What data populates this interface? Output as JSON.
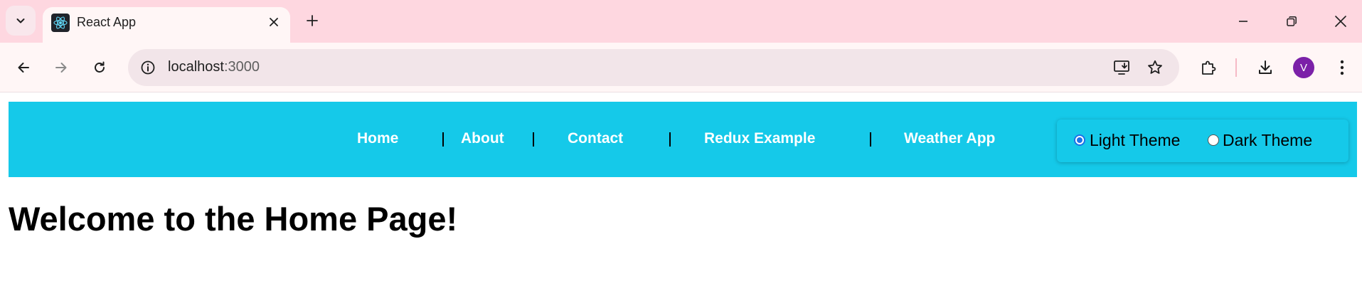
{
  "browser": {
    "tab": {
      "title": "React App",
      "favicon": "react-logo-icon"
    },
    "address_bar": {
      "host": "localhost",
      "port": ":3000"
    },
    "profile_initial": "V",
    "colors": {
      "tabstrip": "#fed7e0",
      "toolbar": "#fff6f6",
      "avatar": "#7b21a8"
    }
  },
  "page": {
    "navbar": {
      "links": [
        {
          "label": "Home"
        },
        {
          "label": "About"
        },
        {
          "label": "Contact"
        },
        {
          "label": "Redux Example"
        },
        {
          "label": "Weather App"
        }
      ],
      "theme_options": [
        {
          "label": "Light Theme",
          "checked": true
        },
        {
          "label": "Dark Theme",
          "checked": false
        }
      ],
      "background": "#15c9e9"
    },
    "heading": "Welcome to the Home Page!"
  }
}
